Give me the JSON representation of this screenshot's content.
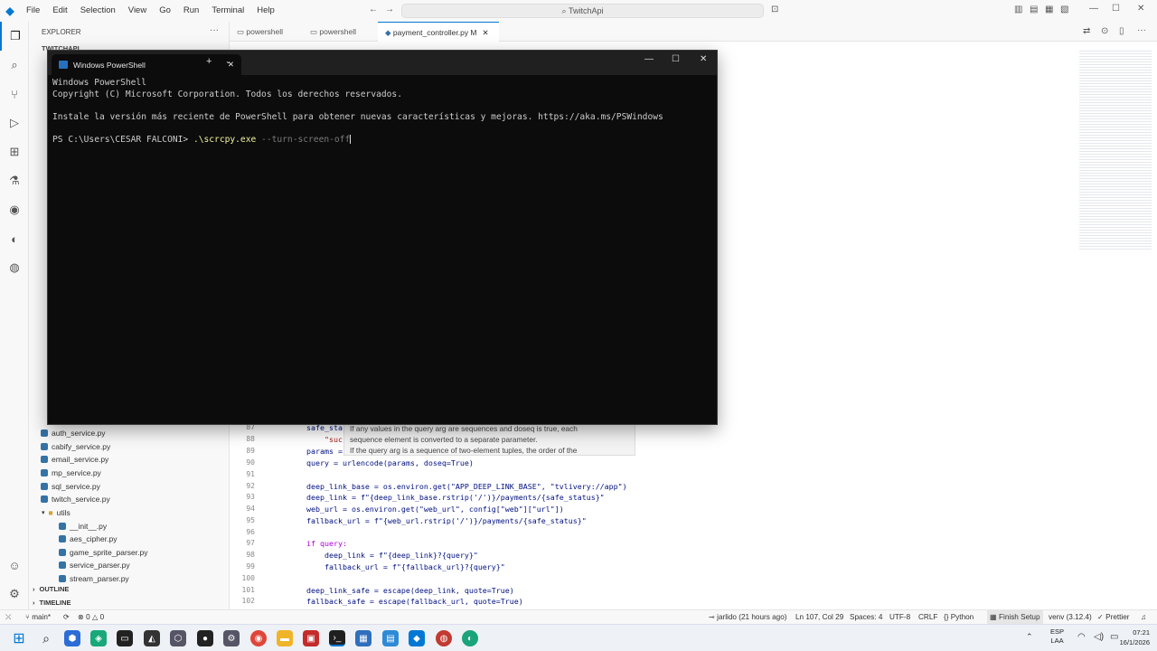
{
  "menu": [
    "File",
    "Edit",
    "Selection",
    "View",
    "Go",
    "Run",
    "Terminal",
    "Help"
  ],
  "command_center": "TwitchApi",
  "sidebar": {
    "header": "EXPLORER",
    "project": "TWITCHAPI",
    "files": [
      "auth_service.py",
      "cabify_service.py",
      "email_service.py",
      "mp_service.py",
      "sql_service.py",
      "twitch_service.py"
    ],
    "folder": "utils",
    "util_files": [
      "__init__.py",
      "aes_cipher.py",
      "game_sprite_parser.py",
      "service_parser.py",
      "stream_parser.py"
    ],
    "outline": "OUTLINE",
    "timeline": "TIMELINE"
  },
  "tabs": [
    {
      "label": "powershell"
    },
    {
      "label": "powershell"
    },
    {
      "label": "payment_controller.py M"
    }
  ],
  "editor": {
    "hover_lines": [
      "If any values in the query arg are sequences and doseq is true, each",
      "sequence element is converted to a separate parameter.",
      "If the query arg is a sequence of two-element tuples, the order of the"
    ],
    "lines": [
      {
        "n": "87",
        "t": "safe_sta"
      },
      {
        "n": "88",
        "t": "    \"suc"
      },
      {
        "n": "89",
        "t": "params = "
      },
      {
        "n": "90",
        "t": "query = urlencode(params, doseq=True)"
      },
      {
        "n": "91",
        "t": ""
      },
      {
        "n": "92",
        "t": "deep_link_base = os.environ.get(\"APP_DEEP_LINK_BASE\", \"tvlivery://app\")"
      },
      {
        "n": "93",
        "t": "deep_link = f\"{deep_link_base.rstrip('/')}/payments/{safe_status}\""
      },
      {
        "n": "94",
        "t": "web_url = os.environ.get(\"web_url\", config[\"web\"][\"url\"])"
      },
      {
        "n": "95",
        "t": "fallback_url = f\"{web_url.rstrip('/')}/payments/{safe_status}\""
      },
      {
        "n": "96",
        "t": ""
      },
      {
        "n": "97",
        "t": "if query:"
      },
      {
        "n": "98",
        "t": "    deep_link = f\"{deep_link}?{query}\""
      },
      {
        "n": "99",
        "t": "    fallback_url = f\"{fallback_url}?{query}\""
      },
      {
        "n": "100",
        "t": ""
      },
      {
        "n": "101",
        "t": "deep_link_safe = escape(deep_link, quote=True)"
      },
      {
        "n": "102",
        "t": "fallback_safe = escape(fallback_url, quote=True)"
      }
    ]
  },
  "powershell": {
    "tab_title": "Windows PowerShell",
    "lines": [
      "Windows PowerShell",
      "Copyright (C) Microsoft Corporation. Todos los derechos reservados.",
      "",
      "Instale la versión más reciente de PowerShell para obtener nuevas características y mejoras. https://aka.ms/PSWindows",
      ""
    ],
    "prompt": "PS C:\\Users\\CESAR FALCONI> ",
    "command": ".\\scrcpy.exe",
    "argument": " --turn-screen-off"
  },
  "statusbar": {
    "branch": "main*",
    "problems": "0",
    "warnings": "0",
    "blame": "jarlido (21 hours ago)",
    "position": "Ln 107, Col 29",
    "spaces": "Spaces: 4",
    "encoding": "UTF-8",
    "eol": "CRLF",
    "language": "Python",
    "setup": "Finish Setup",
    "env": "venv (3.12.4)",
    "formatter": "Prettier"
  },
  "taskbar": {
    "lang": "ESP",
    "region": "LAA",
    "time": "07:21",
    "date": "16/1/2026"
  },
  "colors": {
    "accent": "#0078d4",
    "terminal_bg": "#0c0c0c"
  }
}
